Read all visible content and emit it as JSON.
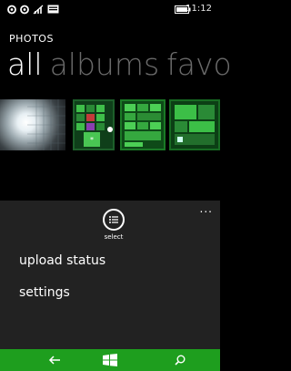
{
  "status_bar": {
    "time": "11:12",
    "icons": [
      "nfc-icon",
      "nfc-icon",
      "signal-icon",
      "message-icon",
      "battery-icon"
    ]
  },
  "app": {
    "title": "PHOTOS"
  },
  "pivot": {
    "items": [
      "all",
      "albums",
      "favo"
    ]
  },
  "app_bar": {
    "select_label": "select",
    "more_label": "...",
    "menu_items": [
      "upload status",
      "settings"
    ]
  },
  "nav_bar": {
    "icons": [
      "back-arrow-icon",
      "windows-logo-icon",
      "search-icon"
    ]
  },
  "colors": {
    "accent": "#1e9e1e",
    "app_bar_bg": "#222222",
    "pivot_inactive": "#6a6a6a"
  }
}
